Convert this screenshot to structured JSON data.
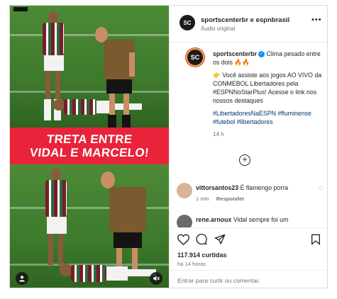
{
  "post": {
    "header": {
      "account": "sportscenterbr e espnbrasil",
      "audio": "Áudio original",
      "avatar_letters": "SC"
    },
    "video": {
      "banner_line1": "TRETA ENTRE",
      "banner_line2": "VIDAL E MARCELO!"
    },
    "caption": {
      "author": "sportscenterbr",
      "lead": "Clima pesado entre os dois 🔥🔥",
      "body": "👉 Você assiste aos jogos AO VIVO da CONMEBOL Libertadores pela #ESPNNoStarPlus! Acesse o link nos nossos destaques",
      "hashtags": "#LibertadoresNaESPN #fluminense #futebol #libertadores",
      "age": "14 h"
    },
    "comments": [
      {
        "user": "vittorsantos23",
        "text": "É flamengo porra",
        "age": "1 min",
        "reply": "Responder"
      },
      {
        "user": "rene.arnoux",
        "text": "Vidal sempre foi um",
        "age": "",
        "reply": ""
      }
    ],
    "likes": "117.914 curtidas",
    "time": "há 14 horas",
    "add_comment": "Entrar para curtir ou comentar."
  },
  "colors": {
    "banner": "#e8233a",
    "link": "#00376b",
    "verified": "#0095f6"
  },
  "icons": [
    "more-icon",
    "heart-icon",
    "comment-icon",
    "share-icon",
    "bookmark-icon",
    "add-comment-circle-icon",
    "mute-icon",
    "user-tag-icon"
  ]
}
